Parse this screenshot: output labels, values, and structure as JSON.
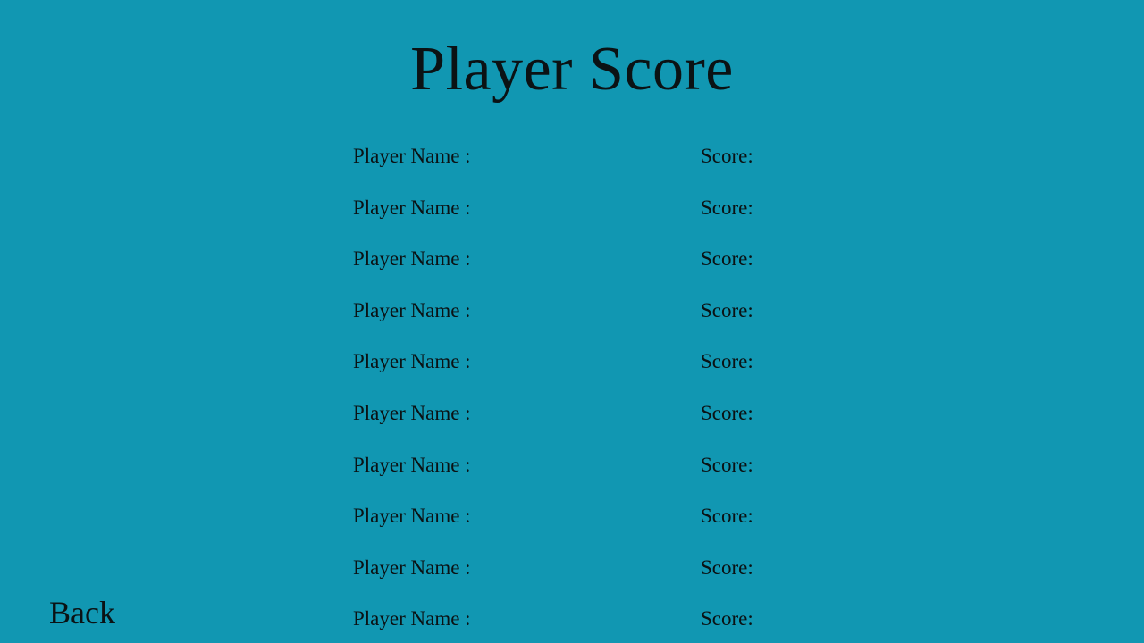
{
  "screen": {
    "title": "Player Score",
    "background_color": "#1197b2",
    "text_color": "#0b1214"
  },
  "scores": {
    "name_label": "Player Name :",
    "score_label": "Score:",
    "rows": [
      {
        "name_label": "Player Name :",
        "score_label": "Score:"
      },
      {
        "name_label": "Player Name :",
        "score_label": "Score:"
      },
      {
        "name_label": "Player Name :",
        "score_label": "Score:"
      },
      {
        "name_label": "Player Name :",
        "score_label": "Score:"
      },
      {
        "name_label": "Player Name :",
        "score_label": "Score:"
      },
      {
        "name_label": "Player Name :",
        "score_label": "Score:"
      },
      {
        "name_label": "Player Name :",
        "score_label": "Score:"
      },
      {
        "name_label": "Player Name :",
        "score_label": "Score:"
      },
      {
        "name_label": "Player Name :",
        "score_label": "Score:"
      },
      {
        "name_label": "Player Name :",
        "score_label": "Score:"
      }
    ]
  },
  "navigation": {
    "back_label": "Back"
  }
}
